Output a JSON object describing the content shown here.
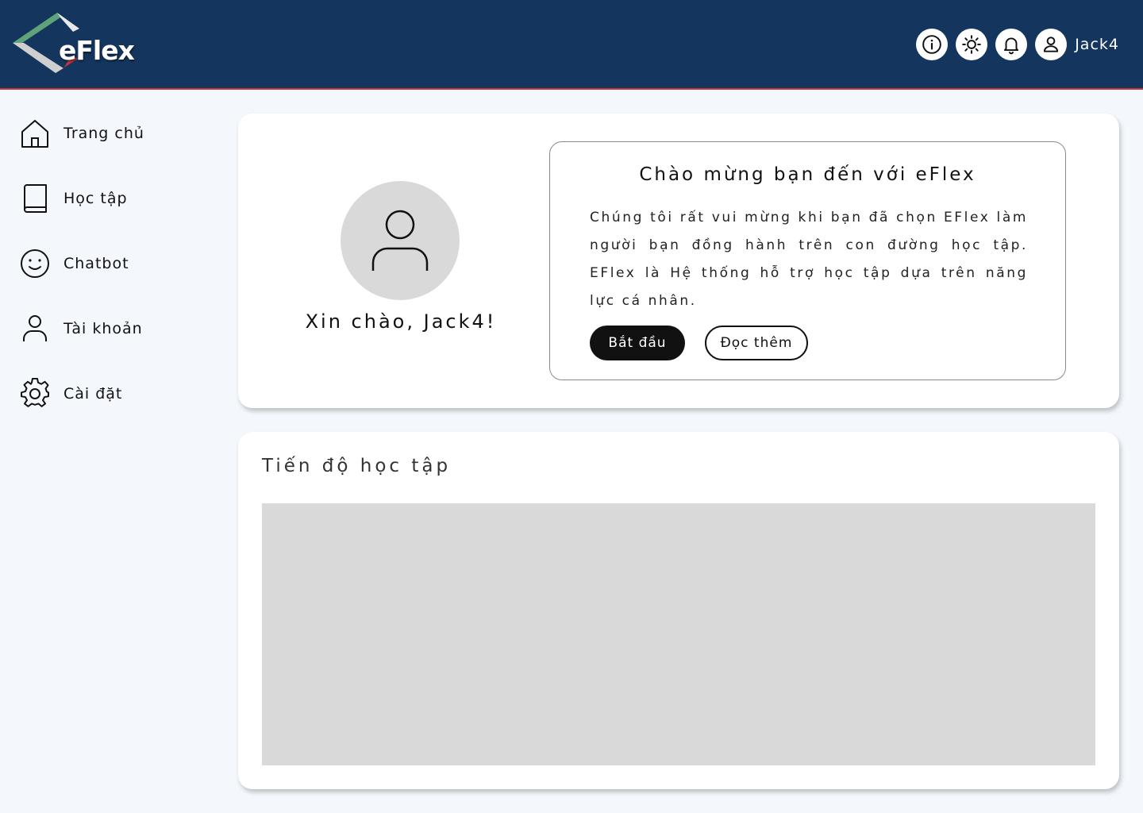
{
  "header": {
    "logo_text": "eFlex",
    "username": "Jack4",
    "icons": [
      "info-icon",
      "theme-toggle-icon",
      "notification-bell-icon",
      "user-icon"
    ]
  },
  "sidebar": {
    "items": [
      {
        "label": "Trang chủ",
        "icon": "home-icon"
      },
      {
        "label": "Học tập",
        "icon": "book-icon"
      },
      {
        "label": "Chatbot",
        "icon": "smiley-icon"
      },
      {
        "label": "Tài khoản",
        "icon": "user-icon"
      },
      {
        "label": "Cài đặt",
        "icon": "gear-icon"
      }
    ]
  },
  "welcome": {
    "greeting": "Xin chào, Jack4!",
    "title": "Chào mừng bạn đến với eFlex",
    "body": "Chúng tôi rất vui mừng khi bạn đã chọn EFlex làm người bạn đồng hành trên con đường học tập. EFlex là Hệ thống hỗ trợ học tập dựa trên năng lực cá nhân.",
    "start_label": "Bắt đầu",
    "more_label": "Đọc thêm"
  },
  "progress": {
    "title": "Tiến độ học tập"
  },
  "colors": {
    "header_bg": "#14355d",
    "header_border": "#c9343d",
    "page_bg": "#f4f8fd",
    "placeholder_gray": "#d9d9d9",
    "primary_button": "#111111"
  }
}
